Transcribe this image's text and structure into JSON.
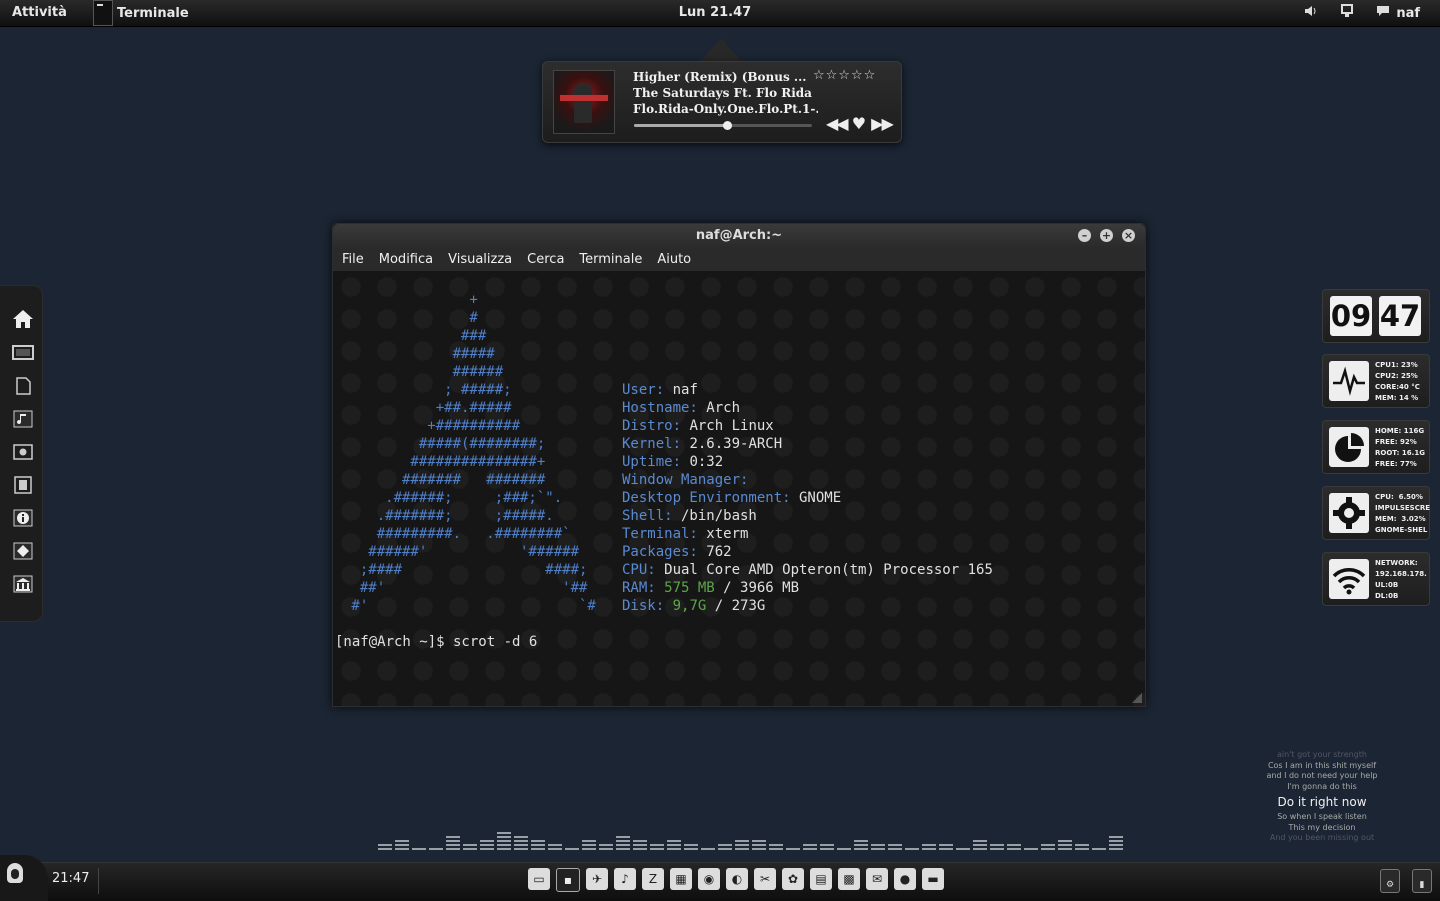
{
  "top_panel": {
    "activities": "Attività",
    "app_menu": "Terminale",
    "clock": "Lun 21.47",
    "user": "naf",
    "volume_icon": "volume-icon",
    "network_icon": "network-icon",
    "chat_icon": "chat-icon"
  },
  "music": {
    "title": "Higher (Remix) (Bonus ...",
    "artist": "The Saturdays Ft. Flo Rida",
    "album": "Flo.Rida-Only.One.Flo.Pt.1-...",
    "stars": "☆☆☆☆☆",
    "progress": 0.52,
    "controls": "◀◀ ♥ ▶▶"
  },
  "terminal": {
    "title": "naf@Arch:~",
    "menu": [
      "File",
      "Modifica",
      "Visualizza",
      "Cerca",
      "Terminale",
      "Aiuto"
    ],
    "arch_logo": [
      "               +",
      "               #",
      "              ###",
      "             #####",
      "             ######",
      "            ; #####;",
      "           +##.#####",
      "          +##########",
      "         #####(########;",
      "        ###############+",
      "       #######   #######",
      "     .######;     ;###;`\".",
      "    .#######;     ;#####.",
      "    #########.   .########`",
      "   ######'           '######",
      "  ;####                 ####;",
      "  ##'                     '##",
      " #'                         `#"
    ],
    "sysinfo": [
      {
        "key": "User:",
        "value": " naf",
        "extra": ""
      },
      {
        "key": "Hostname:",
        "value": " Arch",
        "extra": ""
      },
      {
        "key": "Distro:",
        "value": " Arch Linux",
        "extra": ""
      },
      {
        "key": "Kernel:",
        "value": " 2.6.39-ARCH",
        "extra": ""
      },
      {
        "key": "Uptime:",
        "value": " 0:32",
        "extra": ""
      },
      {
        "key": "Window Manager:",
        "value": "",
        "extra": ""
      },
      {
        "key": "Desktop Environment:",
        "value": " GNOME",
        "extra": ""
      },
      {
        "key": "Shell:",
        "value": " /bin/bash",
        "extra": ""
      },
      {
        "key": "Terminal:",
        "value": " xterm",
        "extra": ""
      },
      {
        "key": "Packages:",
        "value": " 762",
        "extra": ""
      },
      {
        "key": "CPU:",
        "value": " Dual Core AMD Opteron(tm) Processor 165",
        "extra": ""
      }
    ],
    "ram": {
      "key": "RAM:",
      "used": "575 MB",
      "total": " / 3966 MB"
    },
    "disk": {
      "key": "Disk:",
      "used": "9,7G",
      "total": " / 273G"
    },
    "prompt": "[naf@Arch ~]$ scrot -d 6"
  },
  "left_dock": [
    "home-icon",
    "display-icon",
    "document-icon",
    "music-icon",
    "photo-icon",
    "film-icon",
    "info-icon",
    "plugin-icon",
    "bank-icon"
  ],
  "clock_widget": {
    "hours": "09",
    "minutes": "47"
  },
  "widgets": [
    {
      "icon": "pulse-icon",
      "glyph": "〰",
      "lines": "CPU1: 23%\nCPU2: 25%\nCORE:40 °C\nMEM: 14 %"
    },
    {
      "icon": "disk-pie-icon",
      "glyph": "◔",
      "lines": "HOME: 116G\nFREE: 92%\nROOT: 16.1G\nFREE: 77%"
    },
    {
      "icon": "gear-icon",
      "glyph": "⚙",
      "lines": "CPU:  6.50%\nIMPULSESCRE\nMEM:  3.02%\nGNOME-SHEL"
    },
    {
      "icon": "wifi-icon",
      "glyph": "◠",
      "lines": "NETWORK:\n192.168.178.\nUL:0B\nDL:0B"
    }
  ],
  "lyrics": {
    "faint_top": "ain't got your strength",
    "line1": "Cos I am in this shit myself",
    "line2": "and I do not need your help",
    "line3": "I'm gonna do this",
    "current": "Do it right now",
    "line4": "So when I speak listen",
    "line5": "This my decision",
    "faint_bottom": "And you been missing out"
  },
  "bottom_panel": {
    "time": "21:47",
    "launchers": [
      "files-icon",
      "terminal-icon",
      "bird-icon",
      "script-icon",
      "filezilla-icon",
      "photo-editor-icon",
      "media-icon",
      "planet-icon",
      "tools-icon",
      "chat-icon",
      "notes-icon",
      "game-icon",
      "mail-icon",
      "globe-icon",
      "usb-icon"
    ],
    "tray": [
      "gear-tray-icon",
      "system-tray-icon"
    ]
  }
}
